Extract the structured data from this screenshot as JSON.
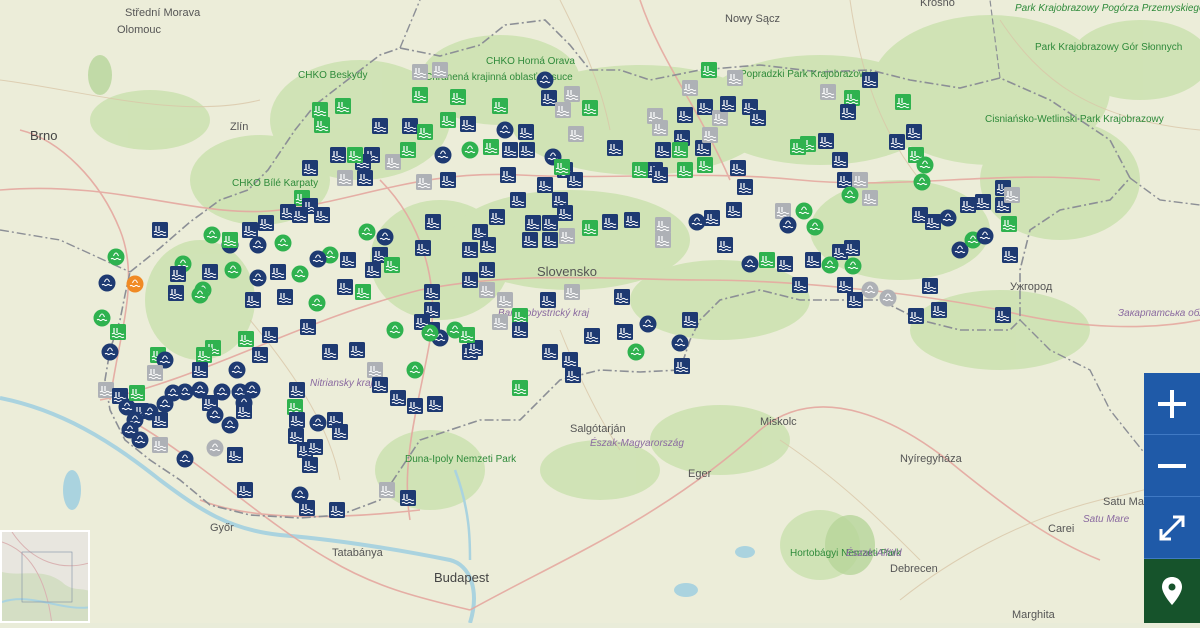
{
  "colors": {
    "navy": "#1e3a72",
    "green": "#2fb24f",
    "gray": "#aeb1b6",
    "orange": "#f08a24",
    "forest": "#cfe4b6",
    "border": "#8c8f96",
    "control": "#1f5aa8",
    "control_locate": "#16532b"
  },
  "icons": {
    "pool": "swimming-pool-icon",
    "lake": "water-body-icon",
    "spring": "spring-icon",
    "zoom_in": "plus-icon",
    "zoom_out": "minus-icon",
    "fullscreen": "expand-arrows-icon",
    "locate": "location-pin-icon"
  },
  "labels": {
    "stredni_morava": "Střední Morava",
    "olomouc": "Olomouc",
    "krosno": "Krosno",
    "nowy_sacz": "Nowy Sącz",
    "pogorze": "Park Krajobrazowy Pogórza Przemyskiego",
    "brno": "Brno",
    "zlin": "Zlín",
    "chko_beskydy": "CHKO Beskydy",
    "chko_horna_orava": "CHKO Horná Orava",
    "kysuce": "Chránená krajinná oblasť Kysuce",
    "popradzki": "Popradzki Park Krajobrazowy",
    "ciezkie": "Park Krajobrazowy Gór Słonnych",
    "cisniansko": "Cisniańsko-Wetlinski Park Krajobrazowy",
    "chko_bile": "CHKO Bílé Karpaty",
    "slovensko": "Slovensko",
    "uzhorod": "Ужгород",
    "zakarpatska": "Закарпатська область",
    "nitriansky": "Nitriansky kraj",
    "banskobystricky": "Banskobystrický kraj",
    "salgotarjan": "Salgótarján",
    "miskolc": "Miskolc",
    "eszak_magyarorszag": "Észak-Magyarország",
    "duna_ipoly": "Duna-Ipoly Nemzeti Park",
    "eger": "Eger",
    "nyiregyhaza": "Nyíregyháza",
    "satu_mare_city": "Satu Mare",
    "satu_mare_region": "Satu Mare",
    "gyor": "Győr",
    "tatabanya": "Tatabánya",
    "budapest": "Budapest",
    "hortobagy": "Hortobágyi Nemzeti Park",
    "eszak_alfold": "Észak-Alföld",
    "debrecen": "Debrecen",
    "carei": "Carei",
    "marghita": "Marghita"
  },
  "map_controls": {
    "zoom_in": "+",
    "zoom_out": "−"
  }
}
